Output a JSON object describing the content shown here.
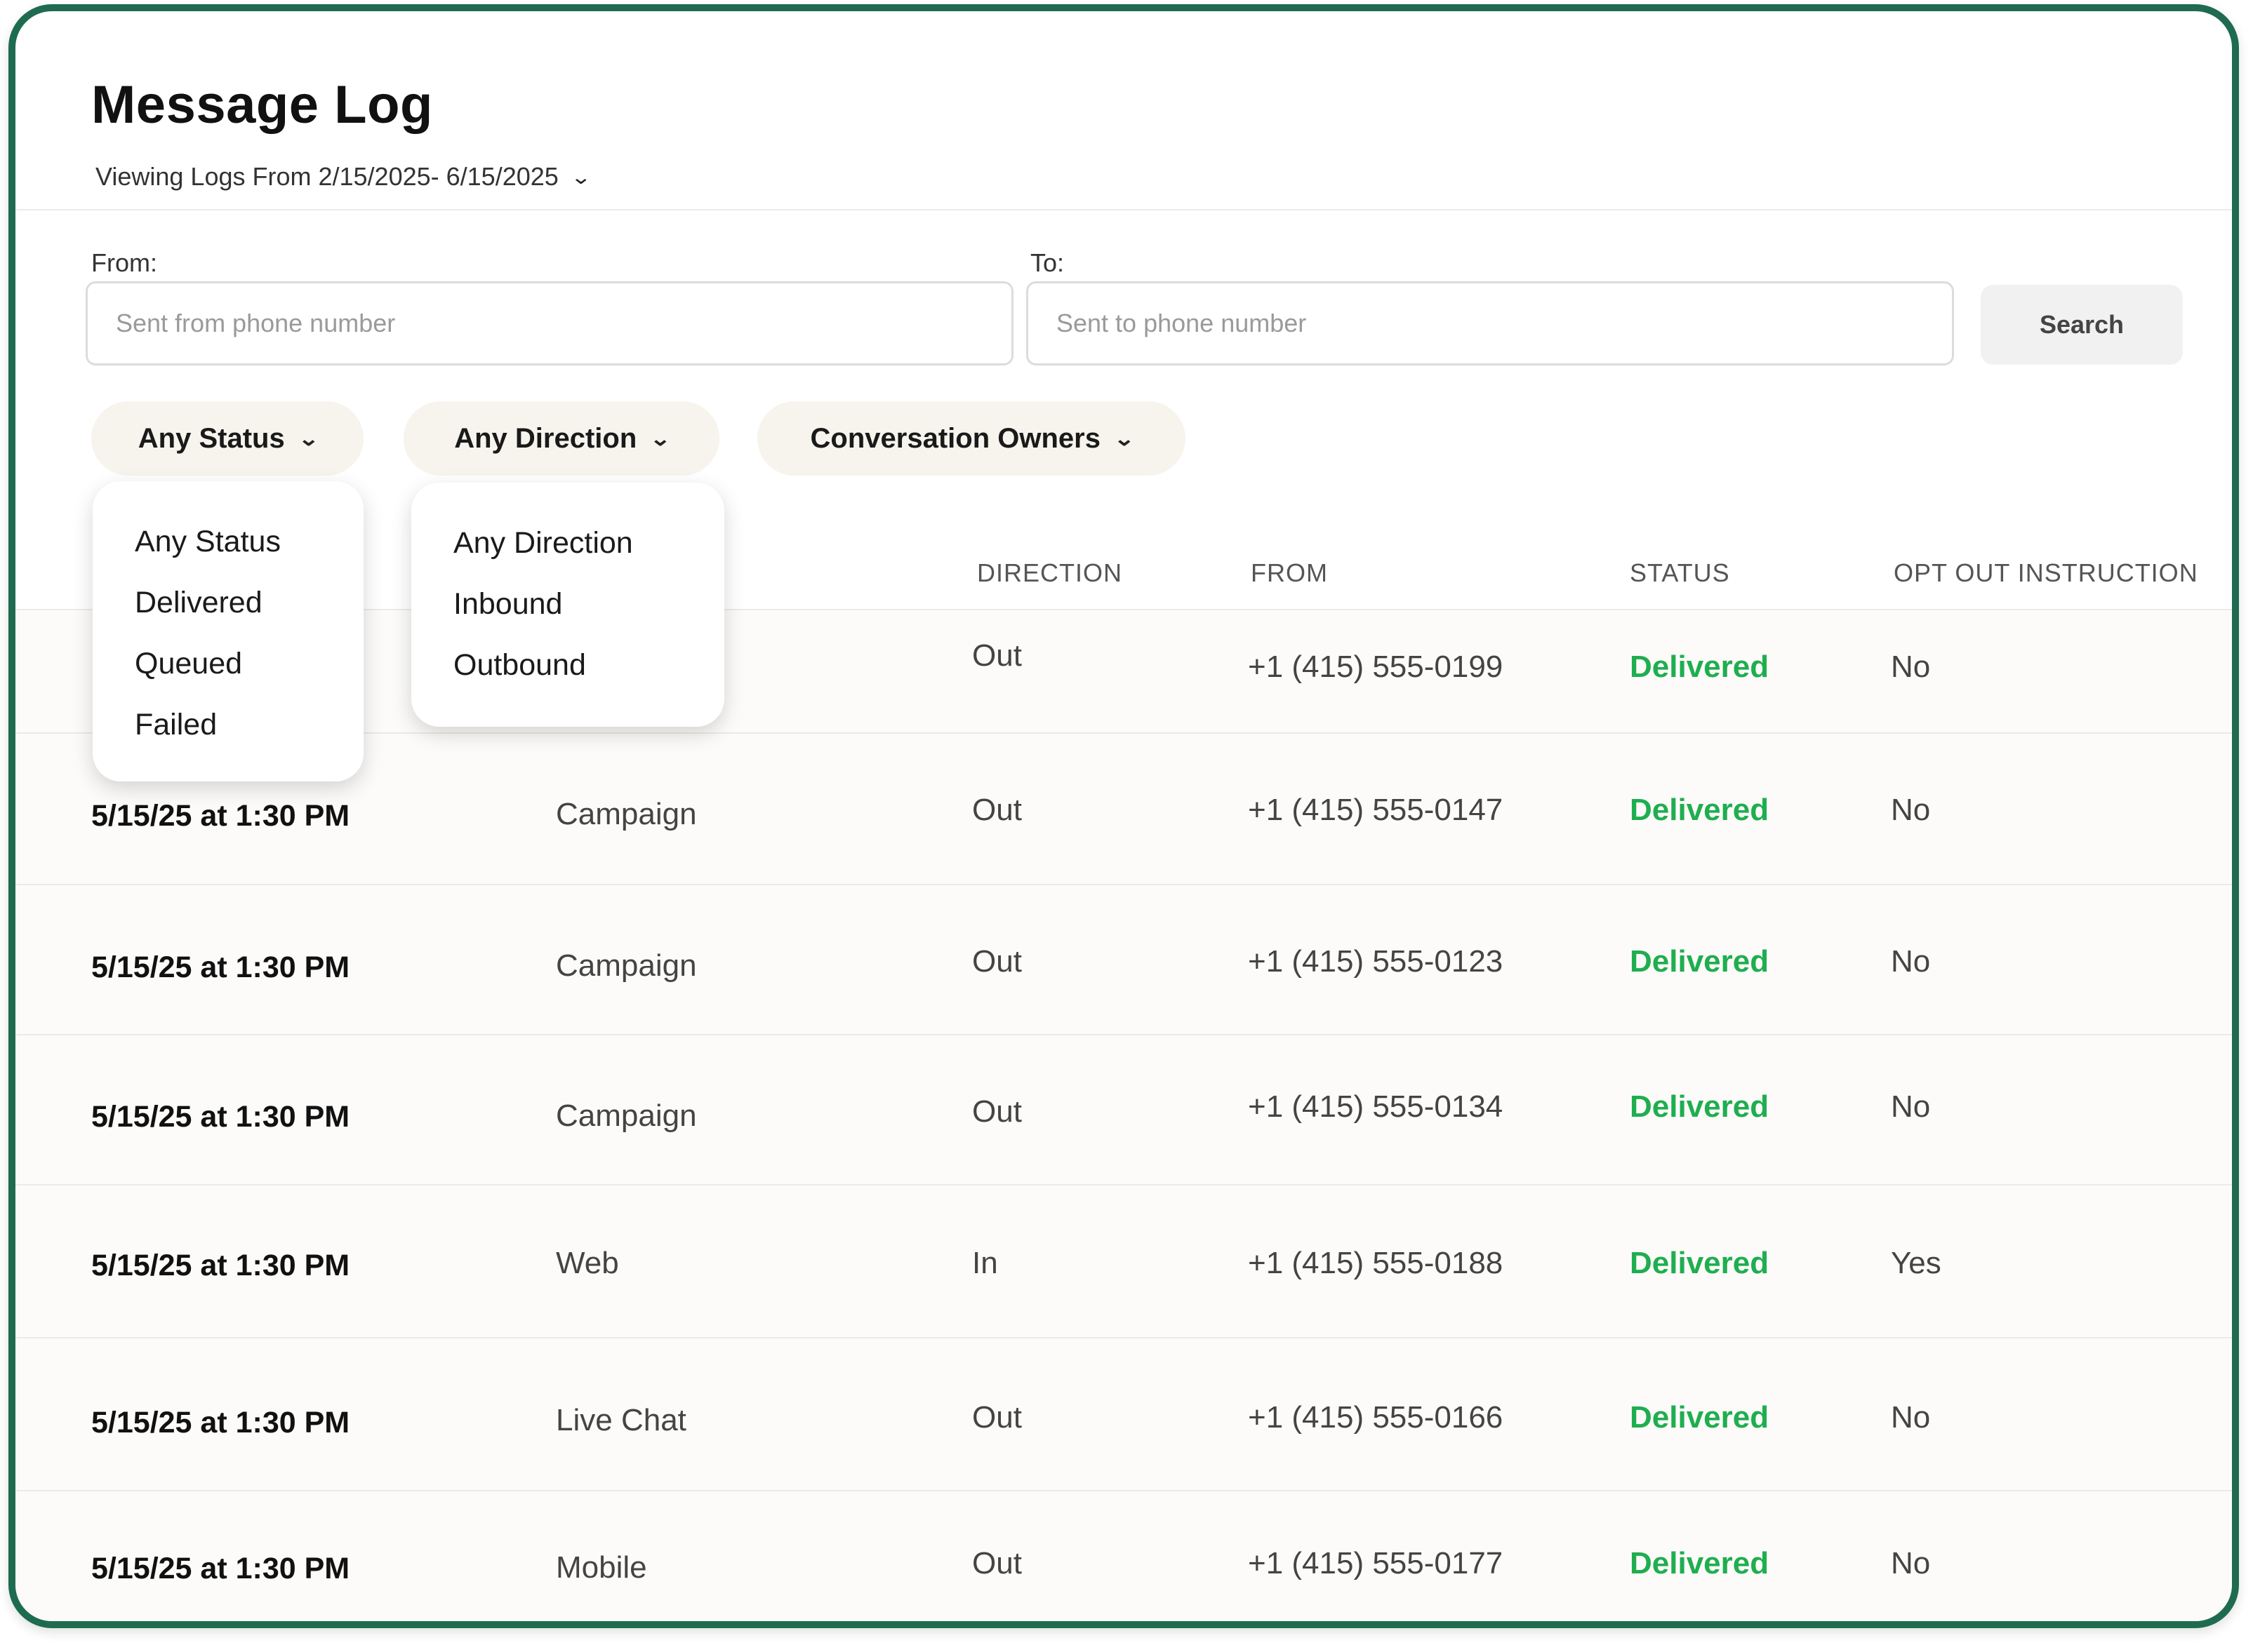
{
  "header": {
    "title": "Message Log",
    "date_range_label": "Viewing Logs From 2/15/2025- 6/15/2025"
  },
  "search": {
    "from_label": "From:",
    "from_placeholder": "Sent from phone number",
    "to_label": "To:",
    "to_placeholder": "Sent to phone number",
    "button_label": "Search"
  },
  "filters": {
    "status": {
      "label": "Any Status",
      "options": [
        "Any Status",
        "Delivered",
        "Queued",
        "Failed"
      ]
    },
    "direction": {
      "label": "Any Direction",
      "options": [
        "Any Direction",
        "Inbound",
        "Outbound"
      ]
    },
    "owners": {
      "label": "Conversation Owners"
    }
  },
  "table": {
    "columns": [
      "DIRECTION",
      "FROM",
      "STATUS",
      "OPT OUT INSTRUCTION"
    ],
    "rows": [
      {
        "date": "",
        "source": "",
        "direction": "Out",
        "from": "+1 (415) 555-0199",
        "status": "Delivered",
        "opt_out": "No"
      },
      {
        "date": "5/15/25 at 1:30 PM",
        "source": "Campaign",
        "direction": "Out",
        "from": "+1 (415) 555-0147",
        "status": "Delivered",
        "opt_out": "No"
      },
      {
        "date": "5/15/25 at 1:30 PM",
        "source": "Campaign",
        "direction": "Out",
        "from": "+1 (415) 555-0123",
        "status": "Delivered",
        "opt_out": "No"
      },
      {
        "date": "5/15/25 at 1:30 PM",
        "source": "Campaign",
        "direction": "Out",
        "from": "+1 (415) 555-0134",
        "status": "Delivered",
        "opt_out": "No"
      },
      {
        "date": "5/15/25 at 1:30 PM",
        "source": "Web",
        "direction": "In",
        "from": "+1 (415) 555-0188",
        "status": "Delivered",
        "opt_out": "Yes"
      },
      {
        "date": "5/15/25 at 1:30 PM",
        "source": "Live Chat",
        "direction": "Out",
        "from": "+1 (415) 555-0166",
        "status": "Delivered",
        "opt_out": "No"
      },
      {
        "date": "5/15/25 at 1:30 PM",
        "source": "Mobile",
        "direction": "Out",
        "from": "+1 (415) 555-0177",
        "status": "Delivered",
        "opt_out": "No"
      }
    ]
  },
  "colors": {
    "frame_border": "#1f6b50",
    "status_delivered": "#1fae4f",
    "pill_bg": "#f7f4ee"
  },
  "icons": {
    "chevron": "chevron-down-icon"
  }
}
